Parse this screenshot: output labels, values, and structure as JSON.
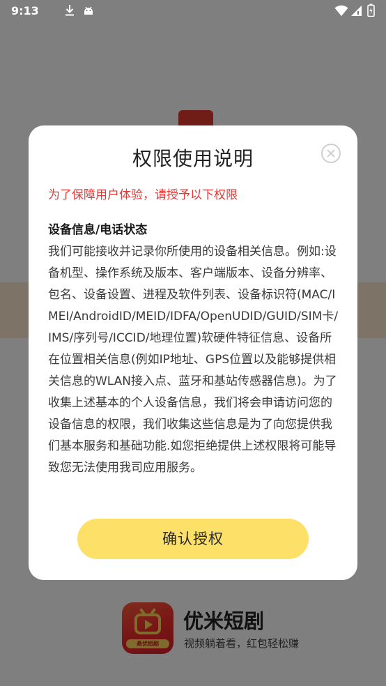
{
  "status_bar": {
    "time": "9:13",
    "icons": [
      "download-icon",
      "android-icon",
      "wifi-icon",
      "signal-icon",
      "battery-icon"
    ]
  },
  "background_app": {
    "app_name": "优米短剧",
    "slogan": "视频躺着看，红包轻松赚",
    "icon_ribbon_text": "悬优短剧"
  },
  "dialog": {
    "title": "权限使用说明",
    "notice": "为了保障用户体验，请授予以下权限",
    "section_heading": "设备信息/电话状态",
    "section_body": "我们可能接收并记录你所使用的设备相关信息。例如:设备机型、操作系统及版本、客户端版本、设备分辨率、包名、设备设置、进程及软件列表、设备标识符(MAC/IMEI/AndroidID/MEID/IDFA/OpenUDID/GUID/SIM卡/IMS/序列号/ICCID/地理位置)软硬件特征信息、设备所在位置相关信息(例如IP地址、GPS位置以及能够提供相关信息的WLAN接入点、蓝牙和基站传感器信息)。为了收集上述基本的个人设备信息，我们将会申请访问您的设备信息的权限，我们收集这些信息是为了向您提供我们基本服务和基础功能.如您拒绝提供上述权限将可能导致您无法使用我司应用服务。",
    "confirm_label": "确认授权"
  },
  "colors": {
    "notice_red": "#e53935",
    "confirm_yellow": "#fde068",
    "scrim": "rgba(0,0,0,0.5)"
  }
}
